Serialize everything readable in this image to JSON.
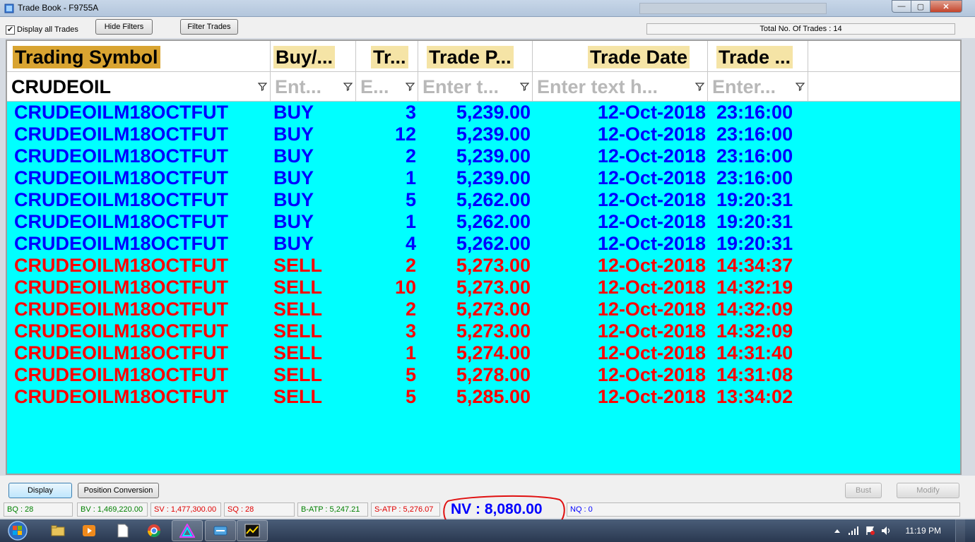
{
  "window": {
    "title": "Trade Book - F9755A",
    "minimize_icon": "minimize-icon",
    "maximize_icon": "maximize-icon",
    "close_icon": "close-icon",
    "minimize_glyph": "—",
    "maximize_glyph": "▢",
    "close_glyph": "✕"
  },
  "toolbar": {
    "display_all_label": "Display all Trades",
    "display_all_checked": true,
    "checkmark": "✔",
    "hide_filters_label": "Hide Filters",
    "filter_trades_label": "Filter Trades",
    "total_trades": "Total No. Of Trades : 14"
  },
  "grid": {
    "columns": [
      {
        "label": "Trading Symbol",
        "filter": "CRUDEOIL"
      },
      {
        "label": "Buy/...",
        "filter": "Ent..."
      },
      {
        "label": "Tr...",
        "filter": "E..."
      },
      {
        "label": "Trade P...",
        "filter": "Enter t..."
      },
      {
        "label": "Trade Date",
        "filter": "Enter text h..."
      },
      {
        "label": "Trade ...",
        "filter": "Enter..."
      }
    ],
    "rows": [
      {
        "symbol": "CRUDEOILM18OCTFUT",
        "side": "BUY",
        "qty": "3",
        "price": "5,239.00",
        "date": "12-Oct-2018",
        "time": "23:16:00"
      },
      {
        "symbol": "CRUDEOILM18OCTFUT",
        "side": "BUY",
        "qty": "12",
        "price": "5,239.00",
        "date": "12-Oct-2018",
        "time": "23:16:00"
      },
      {
        "symbol": "CRUDEOILM18OCTFUT",
        "side": "BUY",
        "qty": "2",
        "price": "5,239.00",
        "date": "12-Oct-2018",
        "time": "23:16:00"
      },
      {
        "symbol": "CRUDEOILM18OCTFUT",
        "side": "BUY",
        "qty": "1",
        "price": "5,239.00",
        "date": "12-Oct-2018",
        "time": "23:16:00"
      },
      {
        "symbol": "CRUDEOILM18OCTFUT",
        "side": "BUY",
        "qty": "5",
        "price": "5,262.00",
        "date": "12-Oct-2018",
        "time": "19:20:31"
      },
      {
        "symbol": "CRUDEOILM18OCTFUT",
        "side": "BUY",
        "qty": "1",
        "price": "5,262.00",
        "date": "12-Oct-2018",
        "time": "19:20:31"
      },
      {
        "symbol": "CRUDEOILM18OCTFUT",
        "side": "BUY",
        "qty": "4",
        "price": "5,262.00",
        "date": "12-Oct-2018",
        "time": "19:20:31"
      },
      {
        "symbol": "CRUDEOILM18OCTFUT",
        "side": "SELL",
        "qty": "2",
        "price": "5,273.00",
        "date": "12-Oct-2018",
        "time": "14:34:37"
      },
      {
        "symbol": "CRUDEOILM18OCTFUT",
        "side": "SELL",
        "qty": "10",
        "price": "5,273.00",
        "date": "12-Oct-2018",
        "time": "14:32:19"
      },
      {
        "symbol": "CRUDEOILM18OCTFUT",
        "side": "SELL",
        "qty": "2",
        "price": "5,273.00",
        "date": "12-Oct-2018",
        "time": "14:32:09"
      },
      {
        "symbol": "CRUDEOILM18OCTFUT",
        "side": "SELL",
        "qty": "3",
        "price": "5,273.00",
        "date": "12-Oct-2018",
        "time": "14:32:09"
      },
      {
        "symbol": "CRUDEOILM18OCTFUT",
        "side": "SELL",
        "qty": "1",
        "price": "5,274.00",
        "date": "12-Oct-2018",
        "time": "14:31:40"
      },
      {
        "symbol": "CRUDEOILM18OCTFUT",
        "side": "SELL",
        "qty": "5",
        "price": "5,278.00",
        "date": "12-Oct-2018",
        "time": "14:31:08"
      },
      {
        "symbol": "CRUDEOILM18OCTFUT",
        "side": "SELL",
        "qty": "5",
        "price": "5,285.00",
        "date": "12-Oct-2018",
        "time": "13:34:02"
      }
    ],
    "buy_color": "#0000ff",
    "sell_color": "#ff0000",
    "background": "#00ffff"
  },
  "bottom": {
    "display_label": "Display",
    "position_conversion_label": "Position Conversion",
    "bust_label": "Bust",
    "modify_label": "Modify"
  },
  "status": {
    "bq": "BQ : 28",
    "bv": "BV : 1,469,220.00",
    "sv": "SV : 1,477,300.00",
    "sq": "SQ : 28",
    "batp": "B-ATP : 5,247.21",
    "satp": "S-ATP : 5,276.07",
    "nv": "NV : 8,080.00",
    "nq": "NQ : 0"
  },
  "taskbar": {
    "clock": "11:19 PM",
    "icons": [
      "start-orb-icon",
      "file-explorer-icon",
      "media-player-icon",
      "document-icon",
      "chrome-icon",
      "trading-app-icon",
      "network-app-icon",
      "chart-app-icon"
    ]
  }
}
